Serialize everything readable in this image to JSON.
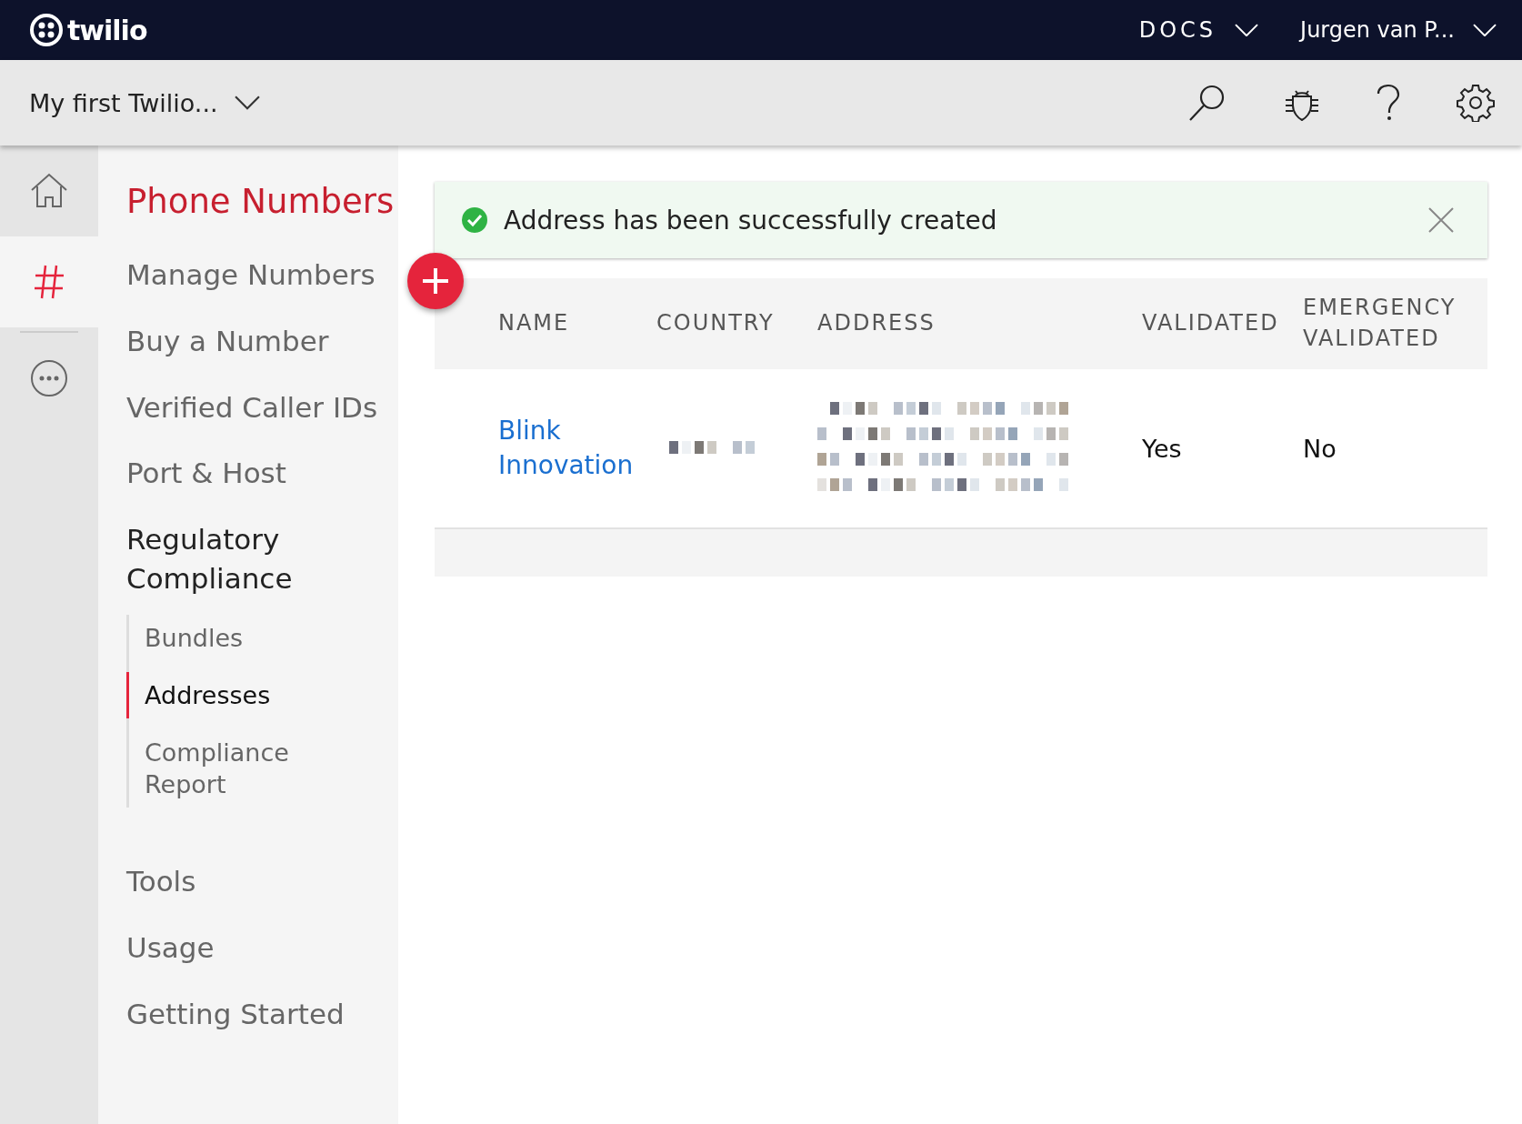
{
  "top_bar": {
    "logo": "twilio",
    "docs": "DOCS",
    "user": "Jurgen van P..."
  },
  "project_bar": {
    "project": "My first Twilio..."
  },
  "rail": [
    {
      "kind": "home",
      "selected": false
    },
    {
      "kind": "hash",
      "selected": true
    },
    {
      "kind": "more",
      "selected": false
    }
  ],
  "sidebar": {
    "title": "Phone Numbers",
    "items": [
      {
        "label": "Manage Numbers"
      },
      {
        "label": "Buy a Number"
      },
      {
        "label": "Verified Caller IDs"
      },
      {
        "label": "Port & Host"
      },
      {
        "label": "Regulatory Compliance",
        "children": [
          {
            "label": "Bundles",
            "selected": false
          },
          {
            "label": "Addresses",
            "selected": true
          },
          {
            "label": "Compliance Report",
            "selected": false
          }
        ]
      },
      {
        "label": "Tools"
      },
      {
        "label": "Usage"
      },
      {
        "label": "Getting Started"
      }
    ]
  },
  "banner": {
    "message": "Address has been successfully created"
  },
  "table": {
    "columns": [
      "NAME",
      "COUNTRY",
      "ADDRESS",
      "VALIDATED",
      "EMERGENCY VALIDATED"
    ],
    "rows": [
      {
        "name": "Blink Innovation",
        "validated": "Yes",
        "emergency_validated": "No"
      }
    ]
  }
}
